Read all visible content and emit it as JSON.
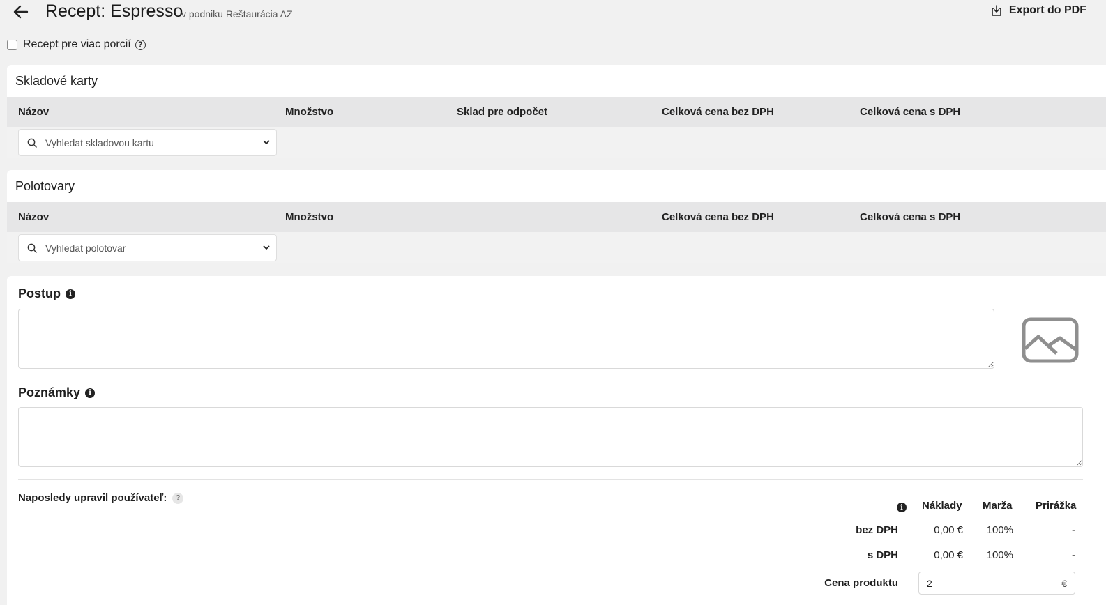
{
  "header": {
    "title": "Recept: Espresso",
    "subtitle": "v podniku Reštaurácia AZ",
    "export_label": "Export do PDF"
  },
  "multi_portion": {
    "label": "Recept pre viac porcií",
    "checked": false,
    "help": "?"
  },
  "stock_cards": {
    "title": "Skladové karty",
    "columns": [
      "Názov",
      "Množstvo",
      "Sklad pre odpočet",
      "Celková cena bez DPH",
      "Celková cena s DPH"
    ],
    "search_placeholder": "Vyhledat skladovou kartu"
  },
  "semi_products": {
    "title": "Polotovary",
    "columns": [
      "Názov",
      "Množstvo",
      "Celková cena bez DPH",
      "Celková cena s DPH"
    ],
    "search_placeholder": "Vyhledat polotovar"
  },
  "procedure": {
    "label": "Postup",
    "value": "",
    "info": "i"
  },
  "notes": {
    "label": "Poznámky",
    "value": "",
    "info": "i"
  },
  "last_edited": {
    "label": "Naposledy upravil používateľ:",
    "help": "?"
  },
  "summary": {
    "info": "i",
    "columns": [
      "Náklady",
      "Marža",
      "Prirážka"
    ],
    "rows": [
      {
        "label": "bez DPH",
        "cost": "0,00 €",
        "margin": "100%",
        "markup": "-"
      },
      {
        "label": "s DPH",
        "cost": "0,00 €",
        "margin": "100%",
        "markup": "-"
      }
    ],
    "price_label": "Cena produktu",
    "price_value": "2",
    "currency": "€"
  },
  "icons": {
    "back": "arrow-left-icon",
    "export": "download-icon",
    "search": "search-icon",
    "chevron": "chevron-down-icon",
    "image": "image-placeholder-icon"
  }
}
